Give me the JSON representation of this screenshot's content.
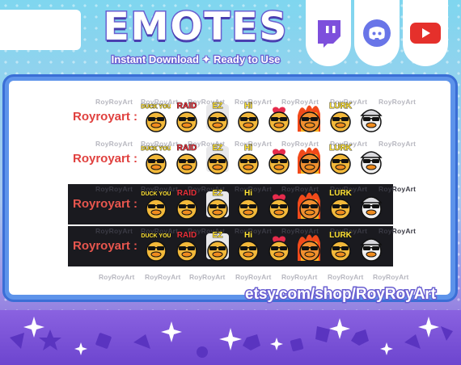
{
  "header": {
    "title": "EMOTES",
    "subtitle": "Instant Download ✦ Ready to Use"
  },
  "social": [
    {
      "name": "twitch-icon",
      "color": "#7d4fdc"
    },
    {
      "name": "discord-icon",
      "color": "#6975e8"
    },
    {
      "name": "youtube-icon",
      "color": "#e5302b"
    }
  ],
  "watermark": "RoyRoyArt",
  "rows": [
    {
      "theme": "light",
      "label": "Royroyart :"
    },
    {
      "theme": "light",
      "label": "Royroyart :"
    },
    {
      "theme": "dark",
      "label": "Royroyart :"
    },
    {
      "theme": "dark",
      "label": "Royroyart :"
    }
  ],
  "emotes": [
    {
      "name": "duck-you",
      "text": "DUCK YOU"
    },
    {
      "name": "raid",
      "text": "RAID"
    },
    {
      "name": "ez",
      "text": "EZ"
    },
    {
      "name": "hi",
      "text": "Hi"
    },
    {
      "name": "love",
      "text": ""
    },
    {
      "name": "rage",
      "text": ""
    },
    {
      "name": "lurk",
      "text": "LURK"
    },
    {
      "name": "cool",
      "text": ""
    }
  ],
  "shop_url": "etsy.com/shop/RoyRoyArt"
}
